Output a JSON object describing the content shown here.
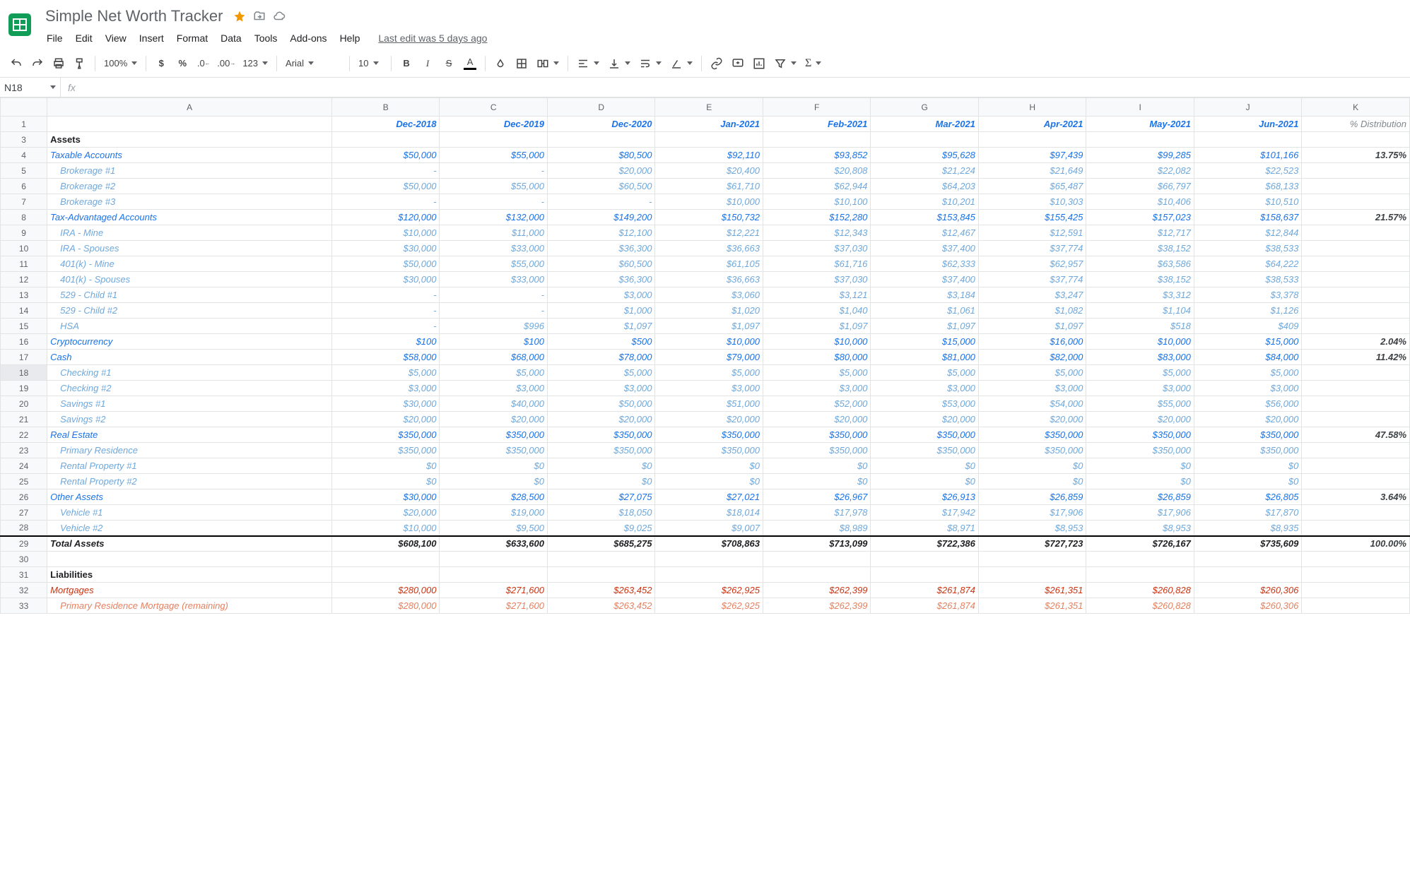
{
  "doc": {
    "title": "Simple Net Worth Tracker",
    "last_edit": "Last edit was 5 days ago"
  },
  "menus": {
    "file": "File",
    "edit": "Edit",
    "view": "View",
    "insert": "Insert",
    "format": "Format",
    "data": "Data",
    "tools": "Tools",
    "addons": "Add-ons",
    "help": "Help"
  },
  "toolbar": {
    "zoom": "100%",
    "font": "Arial",
    "size": "10",
    "more_formats": "123"
  },
  "namebox": {
    "cell": "N18",
    "fx": "fx"
  },
  "columns": [
    "A",
    "B",
    "C",
    "D",
    "E",
    "F",
    "G",
    "H",
    "I",
    "J",
    "K"
  ],
  "col_headers": [
    "Dec-2018",
    "Dec-2019",
    "Dec-2020",
    "Jan-2021",
    "Feb-2021",
    "Mar-2021",
    "Apr-2021",
    "May-2021",
    "Jun-2021",
    "% Distribution"
  ],
  "rows": [
    {
      "r": 1,
      "type": "header"
    },
    {
      "r": 3,
      "type": "section",
      "name": "Assets"
    },
    {
      "r": 4,
      "type": "main",
      "name": "Taxable Accounts",
      "v": [
        "$50,000",
        "$55,000",
        "$80,500",
        "$92,110",
        "$93,852",
        "$95,628",
        "$97,439",
        "$99,285",
        "$101,166"
      ],
      "dist": "13.75%"
    },
    {
      "r": 5,
      "type": "sub",
      "name": "Brokerage #1",
      "v": [
        "-",
        "-",
        "$20,000",
        "$20,400",
        "$20,808",
        "$21,224",
        "$21,649",
        "$22,082",
        "$22,523"
      ],
      "dist": ""
    },
    {
      "r": 6,
      "type": "sub",
      "name": "Brokerage #2",
      "v": [
        "$50,000",
        "$55,000",
        "$60,500",
        "$61,710",
        "$62,944",
        "$64,203",
        "$65,487",
        "$66,797",
        "$68,133"
      ],
      "dist": ""
    },
    {
      "r": 7,
      "type": "sub",
      "name": "Brokerage #3",
      "v": [
        "-",
        "-",
        "-",
        "$10,000",
        "$10,100",
        "$10,201",
        "$10,303",
        "$10,406",
        "$10,510"
      ],
      "dist": ""
    },
    {
      "r": 8,
      "type": "main",
      "name": "Tax-Advantaged Accounts",
      "v": [
        "$120,000",
        "$132,000",
        "$149,200",
        "$150,732",
        "$152,280",
        "$153,845",
        "$155,425",
        "$157,023",
        "$158,637"
      ],
      "dist": "21.57%"
    },
    {
      "r": 9,
      "type": "sub",
      "name": "IRA - Mine",
      "v": [
        "$10,000",
        "$11,000",
        "$12,100",
        "$12,221",
        "$12,343",
        "$12,467",
        "$12,591",
        "$12,717",
        "$12,844"
      ],
      "dist": ""
    },
    {
      "r": 10,
      "type": "sub",
      "name": "IRA - Spouses",
      "v": [
        "$30,000",
        "$33,000",
        "$36,300",
        "$36,663",
        "$37,030",
        "$37,400",
        "$37,774",
        "$38,152",
        "$38,533"
      ],
      "dist": ""
    },
    {
      "r": 11,
      "type": "sub",
      "name": "401(k) - Mine",
      "v": [
        "$50,000",
        "$55,000",
        "$60,500",
        "$61,105",
        "$61,716",
        "$62,333",
        "$62,957",
        "$63,586",
        "$64,222"
      ],
      "dist": ""
    },
    {
      "r": 12,
      "type": "sub",
      "name": "401(k) - Spouses",
      "v": [
        "$30,000",
        "$33,000",
        "$36,300",
        "$36,663",
        "$37,030",
        "$37,400",
        "$37,774",
        "$38,152",
        "$38,533"
      ],
      "dist": ""
    },
    {
      "r": 13,
      "type": "sub",
      "name": "529 - Child #1",
      "v": [
        "-",
        "-",
        "$3,000",
        "$3,060",
        "$3,121",
        "$3,184",
        "$3,247",
        "$3,312",
        "$3,378"
      ],
      "dist": ""
    },
    {
      "r": 14,
      "type": "sub",
      "name": "529 - Child #2",
      "v": [
        "-",
        "-",
        "$1,000",
        "$1,020",
        "$1,040",
        "$1,061",
        "$1,082",
        "$1,104",
        "$1,126"
      ],
      "dist": ""
    },
    {
      "r": 15,
      "type": "sub",
      "name": "HSA",
      "v": [
        "-",
        "$996",
        "$1,097",
        "$1,097",
        "$1,097",
        "$1,097",
        "$1,097",
        "$518",
        "$409"
      ],
      "dist": ""
    },
    {
      "r": 16,
      "type": "main",
      "name": "Cryptocurrency",
      "v": [
        "$100",
        "$100",
        "$500",
        "$10,000",
        "$10,000",
        "$15,000",
        "$16,000",
        "$10,000",
        "$15,000"
      ],
      "dist": "2.04%"
    },
    {
      "r": 17,
      "type": "main",
      "name": "Cash",
      "v": [
        "$58,000",
        "$68,000",
        "$78,000",
        "$79,000",
        "$80,000",
        "$81,000",
        "$82,000",
        "$83,000",
        "$84,000"
      ],
      "dist": "11.42%"
    },
    {
      "r": 18,
      "type": "sub",
      "name": "Checking #1",
      "v": [
        "$5,000",
        "$5,000",
        "$5,000",
        "$5,000",
        "$5,000",
        "$5,000",
        "$5,000",
        "$5,000",
        "$5,000"
      ],
      "dist": ""
    },
    {
      "r": 19,
      "type": "sub",
      "name": "Checking #2",
      "v": [
        "$3,000",
        "$3,000",
        "$3,000",
        "$3,000",
        "$3,000",
        "$3,000",
        "$3,000",
        "$3,000",
        "$3,000"
      ],
      "dist": ""
    },
    {
      "r": 20,
      "type": "sub",
      "name": "Savings #1",
      "v": [
        "$30,000",
        "$40,000",
        "$50,000",
        "$51,000",
        "$52,000",
        "$53,000",
        "$54,000",
        "$55,000",
        "$56,000"
      ],
      "dist": ""
    },
    {
      "r": 21,
      "type": "sub",
      "name": "Savings #2",
      "v": [
        "$20,000",
        "$20,000",
        "$20,000",
        "$20,000",
        "$20,000",
        "$20,000",
        "$20,000",
        "$20,000",
        "$20,000"
      ],
      "dist": ""
    },
    {
      "r": 22,
      "type": "main",
      "name": "Real Estate",
      "v": [
        "$350,000",
        "$350,000",
        "$350,000",
        "$350,000",
        "$350,000",
        "$350,000",
        "$350,000",
        "$350,000",
        "$350,000"
      ],
      "dist": "47.58%"
    },
    {
      "r": 23,
      "type": "sub",
      "name": "Primary Residence",
      "v": [
        "$350,000",
        "$350,000",
        "$350,000",
        "$350,000",
        "$350,000",
        "$350,000",
        "$350,000",
        "$350,000",
        "$350,000"
      ],
      "dist": ""
    },
    {
      "r": 24,
      "type": "sub",
      "name": "Rental Property #1",
      "v": [
        "$0",
        "$0",
        "$0",
        "$0",
        "$0",
        "$0",
        "$0",
        "$0",
        "$0"
      ],
      "dist": ""
    },
    {
      "r": 25,
      "type": "sub",
      "name": "Rental Property #2",
      "v": [
        "$0",
        "$0",
        "$0",
        "$0",
        "$0",
        "$0",
        "$0",
        "$0",
        "$0"
      ],
      "dist": ""
    },
    {
      "r": 26,
      "type": "main",
      "name": "Other Assets",
      "v": [
        "$30,000",
        "$28,500",
        "$27,075",
        "$27,021",
        "$26,967",
        "$26,913",
        "$26,859",
        "$26,859",
        "$26,805"
      ],
      "dist": "3.64%"
    },
    {
      "r": 27,
      "type": "sub",
      "name": "Vehicle #1",
      "v": [
        "$20,000",
        "$19,000",
        "$18,050",
        "$18,014",
        "$17,978",
        "$17,942",
        "$17,906",
        "$17,906",
        "$17,870"
      ],
      "dist": ""
    },
    {
      "r": 28,
      "type": "sub",
      "name": "Vehicle #2",
      "v": [
        "$10,000",
        "$9,500",
        "$9,025",
        "$9,007",
        "$8,989",
        "$8,971",
        "$8,953",
        "$8,953",
        "$8,935"
      ],
      "dist": ""
    },
    {
      "r": 29,
      "type": "total",
      "name": "Total Assets",
      "v": [
        "$608,100",
        "$633,600",
        "$685,275",
        "$708,863",
        "$713,099",
        "$722,386",
        "$727,723",
        "$726,167",
        "$735,609"
      ],
      "dist": "100.00%"
    },
    {
      "r": 30,
      "type": "blank"
    },
    {
      "r": 31,
      "type": "section",
      "name": "Liabilities"
    },
    {
      "r": 32,
      "type": "main-red",
      "name": "Mortgages",
      "v": [
        "$280,000",
        "$271,600",
        "$263,452",
        "$262,925",
        "$262,399",
        "$261,874",
        "$261,351",
        "$260,828",
        "$260,306"
      ],
      "dist": ""
    },
    {
      "r": 33,
      "type": "sub-red",
      "name": "Primary Residence Mortgage (remaining)",
      "v": [
        "$280,000",
        "$271,600",
        "$263,452",
        "$262,925",
        "$262,399",
        "$261,874",
        "$261,351",
        "$260,828",
        "$260,306"
      ],
      "dist": ""
    }
  ]
}
